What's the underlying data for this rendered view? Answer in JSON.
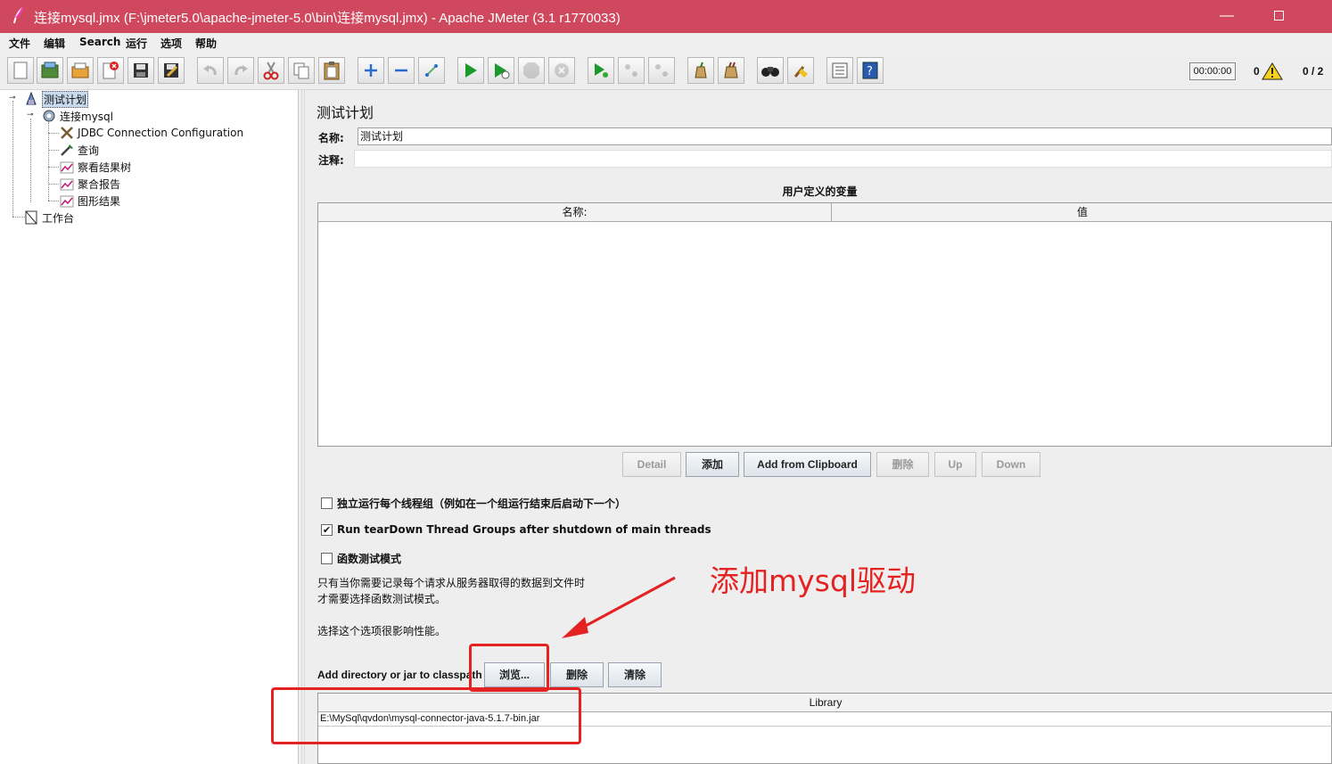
{
  "window": {
    "title": "连接mysql.jmx (F:\\jmeter5.0\\apache-jmeter-5.0\\bin\\连接mysql.jmx) - Apache JMeter (3.1 r1770033)",
    "minimize": "—"
  },
  "menu": [
    "文件",
    "编辑",
    "Search",
    "运行",
    "选项",
    "帮助"
  ],
  "toolbar": {
    "buttons": [
      {
        "icon": "new-icon",
        "enabled": true
      },
      {
        "icon": "templates-icon",
        "enabled": true
      },
      {
        "icon": "open-icon",
        "enabled": true
      },
      {
        "icon": "close-icon",
        "enabled": true
      },
      {
        "icon": "save-icon",
        "enabled": true
      },
      {
        "icon": "save-as-icon",
        "enabled": true
      },
      {
        "icon": "undo-icon",
        "enabled": false
      },
      {
        "icon": "redo-icon",
        "enabled": false
      },
      {
        "icon": "cut-icon",
        "enabled": true
      },
      {
        "icon": "copy-icon",
        "enabled": true
      },
      {
        "icon": "paste-icon",
        "enabled": true
      },
      {
        "icon": "expand-icon",
        "enabled": true
      },
      {
        "icon": "collapse-icon",
        "enabled": true
      },
      {
        "icon": "toggle-icon",
        "enabled": true
      },
      {
        "icon": "start-icon",
        "enabled": true
      },
      {
        "icon": "start-no-pause-icon",
        "enabled": true
      },
      {
        "icon": "stop-icon",
        "enabled": false
      },
      {
        "icon": "shutdown-icon",
        "enabled": false
      },
      {
        "icon": "remote-start-icon",
        "enabled": true
      },
      {
        "icon": "remote-stop-icon",
        "enabled": false
      },
      {
        "icon": "remote-shutdown-icon",
        "enabled": false
      },
      {
        "icon": "clear-icon",
        "enabled": true
      },
      {
        "icon": "clear-all-icon",
        "enabled": true
      },
      {
        "icon": "search-icon",
        "enabled": true
      },
      {
        "icon": "reset-search-icon",
        "enabled": true
      },
      {
        "icon": "function-helper-icon",
        "enabled": true
      },
      {
        "icon": "help-icon",
        "enabled": true
      }
    ],
    "timer": "00:00:00",
    "warnings": "0",
    "threads": "0 / 2"
  },
  "tree": {
    "nodes": [
      {
        "label": "测试计划",
        "icon": "test-plan-icon",
        "selected": true
      },
      {
        "label": "连接mysql",
        "icon": "thread-group-icon"
      },
      {
        "label": "JDBC Connection Configuration",
        "icon": "config-element-icon"
      },
      {
        "label": "查询",
        "icon": "sampler-icon"
      },
      {
        "label": "察看结果树",
        "icon": "listener-icon"
      },
      {
        "label": "聚合报告",
        "icon": "listener-icon"
      },
      {
        "label": "图形结果",
        "icon": "listener-icon"
      },
      {
        "label": "工作台",
        "icon": "workbench-icon"
      }
    ]
  },
  "plan": {
    "heading": "测试计划",
    "name_label": "名称:",
    "name_value": "测试计划",
    "comment_label": "注释:",
    "comment_value": "",
    "variables_title": "用户定义的变量",
    "variables_columns": [
      "名称:",
      "值"
    ],
    "variables_buttons": [
      {
        "label": "Detail",
        "enabled": false
      },
      {
        "label": "添加",
        "enabled": true
      },
      {
        "label": "Add from Clipboard",
        "enabled": true
      },
      {
        "label": "删除",
        "enabled": false
      },
      {
        "label": "Up",
        "enabled": false
      },
      {
        "label": "Down",
        "enabled": false
      }
    ],
    "options": [
      {
        "label": "独立运行每个线程组（例如在一个组运行结束后启动下一个）",
        "checked": false
      },
      {
        "label": "Run tearDown Thread Groups after shutdown of main threads",
        "checked": true
      },
      {
        "label": "函数测试模式",
        "checked": false
      }
    ],
    "functional_note_1": "只有当你需要记录每个请求从服务器取得的数据到文件时",
    "functional_note_2": "才需要选择函数测试模式。",
    "performance_note": "选择这个选项很影响性能。",
    "classpath_label": "Add directory or jar to classpath",
    "classpath_buttons": [
      "浏览...",
      "删除",
      "清除"
    ],
    "library_header": "Library",
    "library_items": [
      "E:\\MySql\\qvdon\\mysql-connector-java-5.1.7-bin.jar"
    ]
  },
  "annotation": {
    "text": "添加mysql驱动",
    "color": "#e52222"
  }
}
